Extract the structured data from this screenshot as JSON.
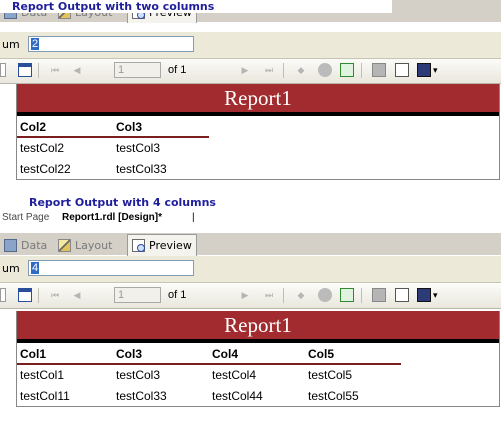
{
  "captions": {
    "top": "Report Output with two columns",
    "bottom": "Report Output with 4 columns"
  },
  "doc_tabs": {
    "start_page": "Start Page",
    "active": "Report1.rdl [Design]*",
    "close_glyph": "|"
  },
  "designer_tabs": {
    "data": "Data",
    "layout": "Layout",
    "preview": "Preview"
  },
  "panel_top": {
    "param_label": "um",
    "param_value": "2",
    "page_number": "1",
    "page_total": "of 1",
    "report_title": "Report1",
    "headers": [
      "Col2",
      "Col3"
    ],
    "rows": [
      [
        "testCol2",
        "testCol3"
      ],
      [
        "testCol22",
        "testCol33"
      ]
    ]
  },
  "panel_bottom": {
    "param_label": "um",
    "param_value": "4",
    "page_number": "1",
    "page_total": "of 1",
    "report_title": "Report1",
    "headers": [
      "Col1",
      "Col3",
      "Col4",
      "Col5"
    ],
    "rows": [
      [
        "testCol1",
        "testCol3",
        "testCol4",
        "testCol5"
      ],
      [
        "testCol11",
        "testCol33",
        "testCol44",
        "testCol55"
      ]
    ]
  },
  "toolbar": {
    "first_page_glyph": "⏮",
    "prev_page_glyph": "◀",
    "next_page_glyph": "▶",
    "last_page_glyph": "⏭",
    "back_glyph": "◆",
    "dropdown_glyph": "▾"
  },
  "colors": {
    "report_banner": "#a12b2e",
    "caption": "#1f1f9c",
    "header_rule": "#7a1f1f"
  }
}
